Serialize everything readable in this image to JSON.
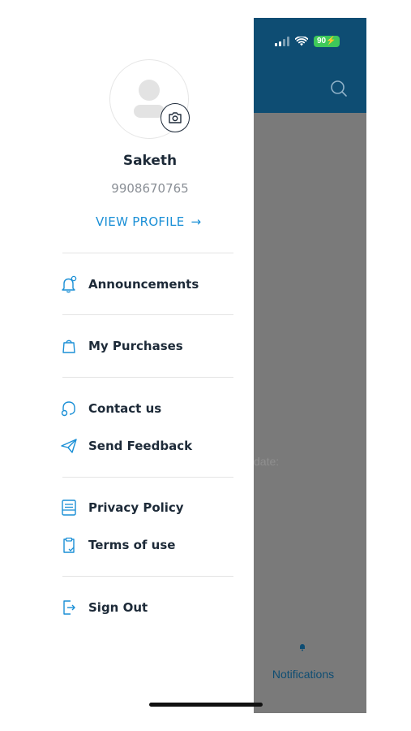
{
  "status_bar": {
    "battery": "90"
  },
  "background_app": {
    "faded_text": "date:",
    "tab_label": "Notifications"
  },
  "profile": {
    "name": "Saketh",
    "phone": "9908670765",
    "view_profile_label": "VIEW PROFILE",
    "view_profile_arrow": "→"
  },
  "menu": {
    "announcements": "Announcements",
    "my_purchases": "My Purchases",
    "contact_us": "Contact us",
    "send_feedback": "Send Feedback",
    "privacy_policy": "Privacy Policy",
    "terms_of_use": "Terms of use",
    "sign_out": "Sign Out"
  },
  "colors": {
    "accent": "#1a8fd6",
    "header": "#0e4d73",
    "text_primary": "#1d2a38",
    "text_secondary": "#8a8f96",
    "overlay": "#7a7a7a"
  }
}
